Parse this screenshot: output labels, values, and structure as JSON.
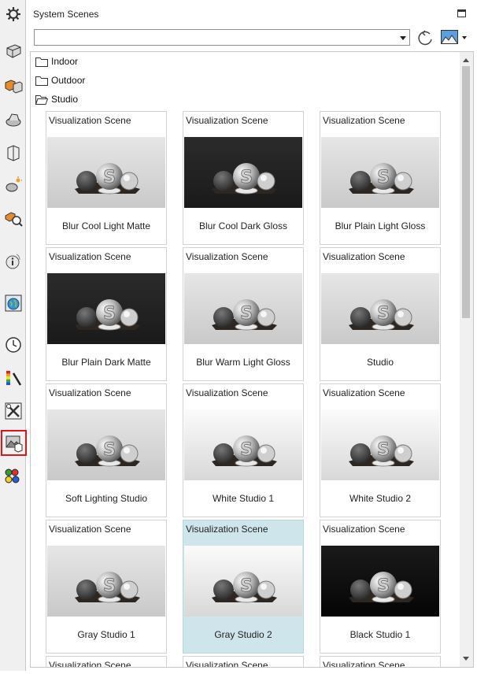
{
  "toolbar": {
    "items": [
      {
        "icon": "settings-gear-icon",
        "selected": false
      },
      {
        "icon": "part-icon",
        "selected": false
      },
      {
        "icon": "assembly-icon",
        "selected": false
      },
      {
        "icon": "materials-icon",
        "selected": false
      },
      {
        "icon": "document-properties-icon",
        "selected": false
      },
      {
        "icon": "light-icon",
        "selected": false
      },
      {
        "icon": "camera-icon",
        "selected": false
      },
      {
        "icon": "info-icon",
        "selected": false
      },
      {
        "icon": "environment-globe-icon",
        "selected": false
      },
      {
        "icon": "clock-icon",
        "selected": false
      },
      {
        "icon": "appearance-palette-icon",
        "selected": false
      },
      {
        "icon": "tools-icon",
        "selected": false
      },
      {
        "icon": "scenes-icon",
        "selected": true
      },
      {
        "icon": "decals-icon",
        "selected": false
      }
    ],
    "selected_outline_color": "#e0141c"
  },
  "panel": {
    "title": "System Scenes",
    "scene_select_value": "",
    "folders": [
      "Indoor",
      "Outdoor",
      "Studio"
    ]
  },
  "scenes": [
    {
      "header": "Visualization Scene",
      "name": "Blur Cool Light Matte",
      "bg": "light",
      "selected": false
    },
    {
      "header": "Visualization Scene",
      "name": "Blur Cool Dark Gloss",
      "bg": "dark",
      "selected": false
    },
    {
      "header": "Visualization Scene",
      "name": "Blur Plain Light Gloss",
      "bg": "light",
      "selected": false
    },
    {
      "header": "Visualization Scene",
      "name": "Blur Plain Dark Matte",
      "bg": "dark",
      "selected": false
    },
    {
      "header": "Visualization Scene",
      "name": "Blur Warm Light Gloss",
      "bg": "light",
      "selected": false
    },
    {
      "header": "Visualization Scene",
      "name": "Studio",
      "bg": "light",
      "selected": false
    },
    {
      "header": "Visualization Scene",
      "name": "Soft Lighting Studio",
      "bg": "light",
      "selected": false
    },
    {
      "header": "Visualization Scene",
      "name": "White Studio 1",
      "bg": "white",
      "selected": false
    },
    {
      "header": "Visualization Scene",
      "name": "White Studio 2",
      "bg": "white",
      "selected": false
    },
    {
      "header": "Visualization Scene",
      "name": "Gray Studio 1",
      "bg": "light",
      "selected": false
    },
    {
      "header": "Visualization Scene",
      "name": "Gray Studio 2",
      "bg": "white",
      "selected": true
    },
    {
      "header": "Visualization Scene",
      "name": "Black Studio 1",
      "bg": "black",
      "selected": false
    }
  ],
  "partial_row": [
    "Visualization Scene",
    "Visualization Scene",
    "Visualization Scene"
  ],
  "colors": {
    "selected_card_bg": "#cfe5ec",
    "card_border": "#d3d3d3"
  }
}
